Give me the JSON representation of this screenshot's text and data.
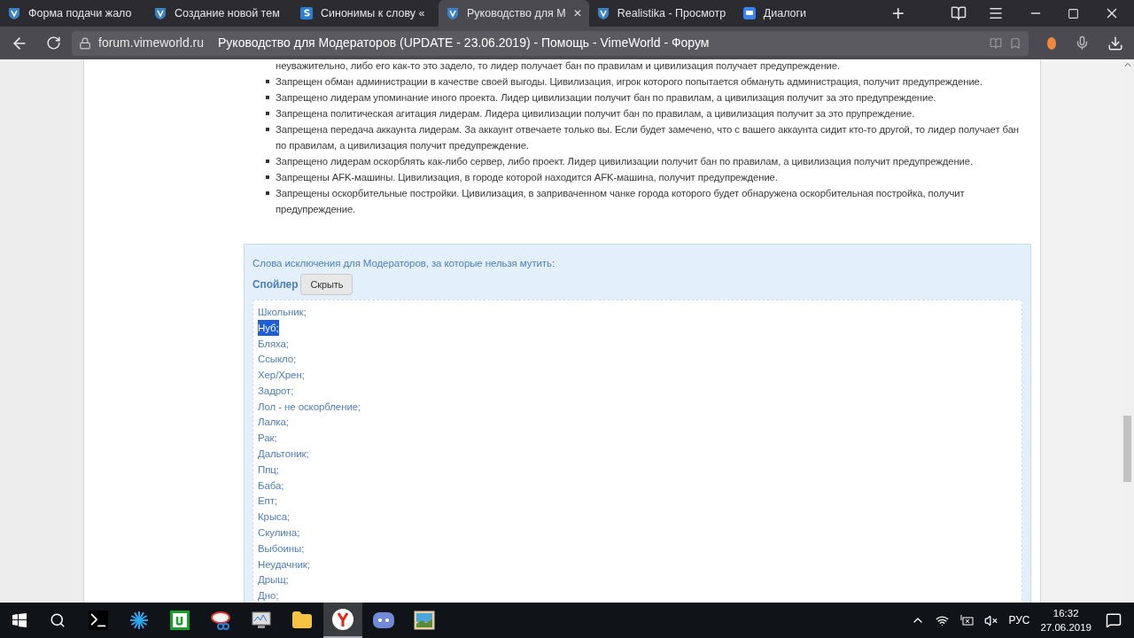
{
  "tabs": [
    {
      "title": "Форма подачи жало",
      "kind": "shield",
      "selected": false
    },
    {
      "title": "Создание новой тем",
      "kind": "shield",
      "selected": false
    },
    {
      "title": "Синонимы к слову «",
      "kind": "square",
      "selected": false
    },
    {
      "title": "Руководство для М",
      "kind": "shield",
      "selected": true,
      "close": "✕"
    },
    {
      "title": "Realistika - Просмотр",
      "kind": "shield",
      "selected": false
    },
    {
      "title": "Диалоги",
      "kind": "chat",
      "selected": false
    }
  ],
  "new_tab": "+",
  "address": {
    "domain": "forum.vimeworld.ru",
    "title": "Руководство для Модераторов (UPDATE - 23.06.2019) - Помощь - VimeWorld - Форум"
  },
  "rules_cont": "неуважительно, либо его как-то это задело, то лидер получает бан по правилам и цивилизация получает предупреждение.",
  "rules": [
    "Запрещен обман администрации в качестве своей выгоды. Цивилизация, игрок которого попытается обмануть администрация, получит предупреждение.",
    "Запрещено лидерам упоминание иного проекта. Лидер цивилизации получит бан по правилам, а цивилизация получит за это предупреждение.",
    "Запрещена политическая агитация лидерам. Лидера цивилизации получит бан по правилам, а цивилизация получит за это прупреждение.",
    "Запрещена передача аккаунта лидерам. За аккаунт отвечаете только вы. Если будет замечено, что с вашего аккаунта сидит кто-то другой, то лидер получает бан по правилам, а цивилизация получит предупреждение.",
    "Запрещено лидерам оскорблять как-либо сервер, либо проект. Лидер цивилизации получит бан по правилам, а цивилизация получит предупреждение.",
    "Запрещены AFK-машины. Цивилизация, в городе которой находится AFK-машина, получит предупреждение.",
    "Запрещены оскорбительные постройки. Цивилизация, в заприваченном чанке города которого будет обнаружена оскорбительная постройка, получит предупреждение."
  ],
  "spoiler": {
    "heading": "Слова исключения для Модераторов, за которые нельзя мутить:",
    "label": "Спойлер",
    "button": "Скрыть",
    "words": [
      {
        "text": "Школьник;",
        "selected": false
      },
      {
        "text": "Нуб;",
        "selected": true
      },
      {
        "text": "Бляха;",
        "selected": false
      },
      {
        "text": "Ссыкло;",
        "selected": false
      },
      {
        "text": "Хер/Хрен;",
        "selected": false
      },
      {
        "text": "Задрот;",
        "selected": false
      },
      {
        "text": "Лол - не оскорбление;",
        "selected": false
      },
      {
        "text": "Лалка;",
        "selected": false
      },
      {
        "text": "Рак;",
        "selected": false
      },
      {
        "text": "Дальтоник;",
        "selected": false
      },
      {
        "text": "Ппц;",
        "selected": false
      },
      {
        "text": "Баба;",
        "selected": false
      },
      {
        "text": "Епт;",
        "selected": false
      },
      {
        "text": "Крыса;",
        "selected": false
      },
      {
        "text": "Скулина;",
        "selected": false
      },
      {
        "text": "Выбоины;",
        "selected": false
      },
      {
        "text": "Неудачник;",
        "selected": false
      },
      {
        "text": "Дрыщ;",
        "selected": false
      },
      {
        "text": "Дно;",
        "selected": false
      }
    ]
  },
  "taskbar": {
    "apps": [
      {
        "kind": "terminal",
        "selected": false
      },
      {
        "kind": "star",
        "selected": false
      },
      {
        "kind": "torrent",
        "selected": false
      },
      {
        "kind": "scissors",
        "selected": false
      },
      {
        "kind": "monitor",
        "selected": false
      },
      {
        "kind": "folder",
        "selected": false
      },
      {
        "kind": "browser",
        "selected": true
      },
      {
        "kind": "discord",
        "selected": false
      },
      {
        "kind": "photos",
        "selected": false
      }
    ],
    "language": "РУС",
    "time": "16:32",
    "date": "27.06.2019"
  }
}
